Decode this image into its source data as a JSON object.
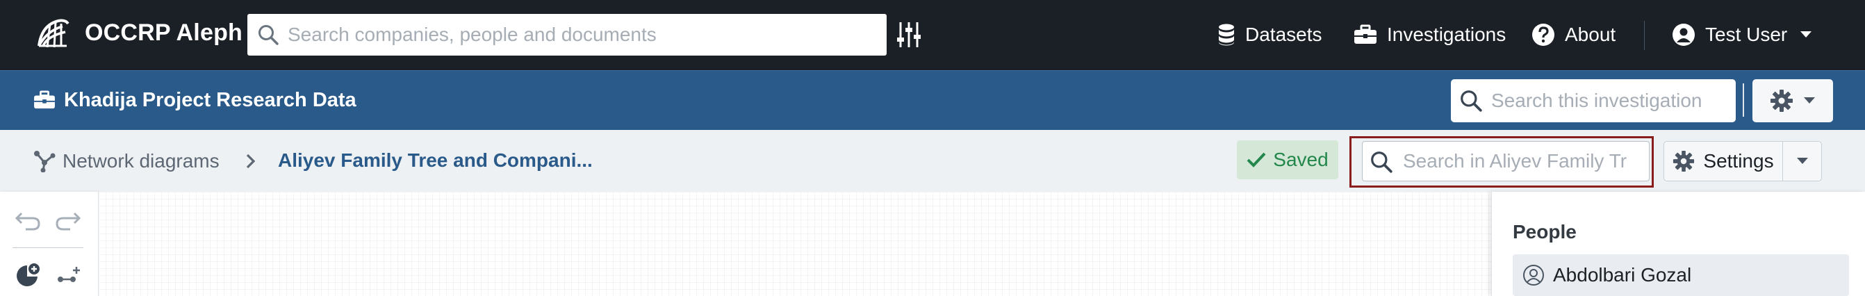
{
  "navbar": {
    "app_title": "OCCRP Aleph",
    "search_placeholder": "Search companies, people and documents",
    "links": [
      {
        "label": "Datasets",
        "icon": "database-icon"
      },
      {
        "label": "Investigations",
        "icon": "briefcase-icon"
      },
      {
        "label": "About",
        "icon": "help-icon"
      }
    ],
    "user": {
      "label": "Test User",
      "icon": "user-icon"
    }
  },
  "investigation": {
    "title": "Khadija Project Research Data",
    "search_placeholder": "Search this investigation"
  },
  "breadcrumb": {
    "section": "Network diagrams",
    "current": "Aliyev Family Tree and Compani..."
  },
  "status": {
    "saved_label": "Saved"
  },
  "diagram": {
    "search_placeholder": "Search in Aliyev Family Tr",
    "settings_label": "Settings"
  },
  "sidebar": {
    "people_heading": "People",
    "people": [
      {
        "name": "Abdolbari Gozal"
      }
    ]
  },
  "colors": {
    "navbar_bg": "#1b2027",
    "investigation_bar_bg": "#2a5a8a",
    "breadcrumb_bg": "#eef1f4",
    "accent_blue": "#2a5a8a",
    "saved_green": "#23874b",
    "highlight_outline": "#8b1c1c"
  }
}
